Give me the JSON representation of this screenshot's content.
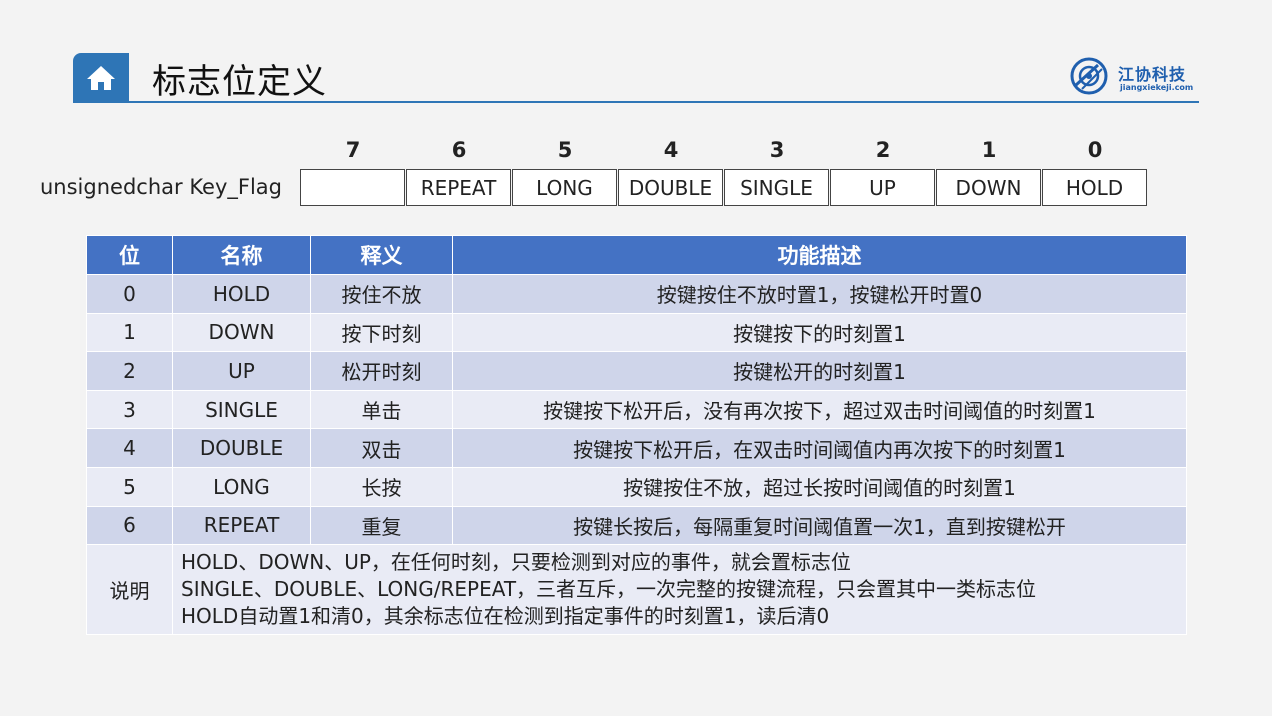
{
  "header": {
    "title": "标志位定义",
    "icon": "home-icon",
    "accent_color": "#2e75b6"
  },
  "logo": {
    "name": "江协科技",
    "url": "jiangxiekeji.com",
    "icon": "logo-mark-icon"
  },
  "bit_diagram": {
    "label": "unsignedchar Key_Flag",
    "bits": [
      {
        "num": "7",
        "name": ""
      },
      {
        "num": "6",
        "name": "REPEAT"
      },
      {
        "num": "5",
        "name": "LONG"
      },
      {
        "num": "4",
        "name": "DOUBLE"
      },
      {
        "num": "3",
        "name": "SINGLE"
      },
      {
        "num": "2",
        "name": "UP"
      },
      {
        "num": "1",
        "name": "DOWN"
      },
      {
        "num": "0",
        "name": "HOLD"
      }
    ]
  },
  "table": {
    "header_color": "#4472c4",
    "headers": [
      "位",
      "名称",
      "释义",
      "功能描述"
    ],
    "rows": [
      {
        "bit": "0",
        "name": "HOLD",
        "meaning": "按住不放",
        "desc": "按键按住不放时置1，按键松开时置0"
      },
      {
        "bit": "1",
        "name": "DOWN",
        "meaning": "按下时刻",
        "desc": "按键按下的时刻置1"
      },
      {
        "bit": "2",
        "name": "UP",
        "meaning": "松开时刻",
        "desc": "按键松开的时刻置1"
      },
      {
        "bit": "3",
        "name": "SINGLE",
        "meaning": "单击",
        "desc": "按键按下松开后，没有再次按下，超过双击时间阈值的时刻置1"
      },
      {
        "bit": "4",
        "name": "DOUBLE",
        "meaning": "双击",
        "desc": "按键按下松开后，在双击时间阈值内再次按下的时刻置1"
      },
      {
        "bit": "5",
        "name": "LONG",
        "meaning": "长按",
        "desc": "按键按住不放，超过长按时间阈值的时刻置1"
      },
      {
        "bit": "6",
        "name": "REPEAT",
        "meaning": "重复",
        "desc": "按键长按后，每隔重复时间阈值置一次1，直到按键松开"
      }
    ],
    "note": {
      "label": "说明",
      "lines": [
        "HOLD、DOWN、UP，在任何时刻，只要检测到对应的事件，就会置标志位",
        "SINGLE、DOUBLE、LONG/REPEAT，三者互斥，一次完整的按键流程，只会置其中一类标志位",
        "HOLD自动置1和清0，其余标志位在检测到指定事件的时刻置1，读后清0"
      ]
    }
  }
}
